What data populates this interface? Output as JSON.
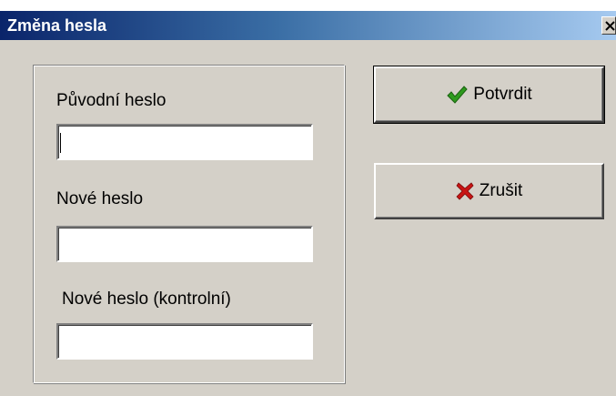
{
  "window": {
    "title": "Změna hesla"
  },
  "form": {
    "original_password_label": "Původní heslo",
    "original_password_value": "",
    "new_password_label": "Nové heslo",
    "new_password_value": "",
    "confirm_password_label": "Nové heslo (kontrolní)",
    "confirm_password_value": ""
  },
  "buttons": {
    "confirm_label": "Potvrdit",
    "confirm_icon": "checkmark-icon",
    "cancel_label": "Zrušit",
    "cancel_icon": "red-x-icon"
  },
  "colors": {
    "title_gradient_start": "#0a246a",
    "title_gradient_end": "#a6caf0",
    "window_face": "#d4d0c8",
    "check_green": "#2e9a1e",
    "cancel_red": "#c81414"
  }
}
